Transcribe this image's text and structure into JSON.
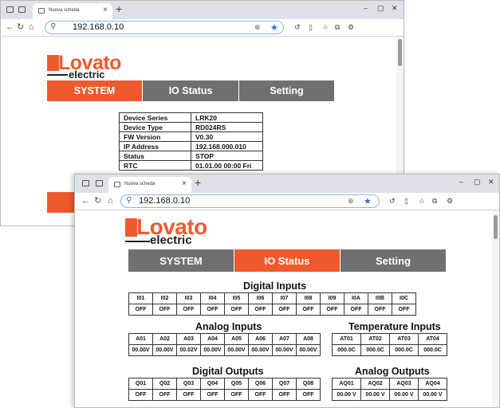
{
  "back_window": {
    "tab_title": "Nuova scheda",
    "url": "192.168.0.10",
    "logo_main": "Lovato",
    "logo_sub": "electric",
    "menu": [
      "SYSTEM",
      "IO Status",
      "Setting"
    ],
    "device_info": [
      {
        "label": "Device Series",
        "value": "LRK20"
      },
      {
        "label": "Device Type",
        "value": "RD024RS"
      },
      {
        "label": "FW Version",
        "value": "V0.30"
      },
      {
        "label": "IP Address",
        "value": "192.168.000.010"
      },
      {
        "label": "Status",
        "value": "STOP"
      },
      {
        "label": "RTC",
        "value": "01.01.00 00:00 Fri"
      }
    ]
  },
  "front_window": {
    "tab_title": "Nuova scheda",
    "url": "192.168.0.10",
    "logo_main": "Lovato",
    "logo_sub": "electric",
    "menu": [
      "SYSTEM",
      "IO Status",
      "Setting"
    ],
    "digital_inputs": {
      "title": "Digital Inputs",
      "headers": [
        "I01",
        "I02",
        "I03",
        "I04",
        "I05",
        "I06",
        "I07",
        "I08",
        "I09",
        "I0A",
        "I0B",
        "I0C"
      ],
      "values": [
        "OFF",
        "OFF",
        "OFF",
        "OFF",
        "OFF",
        "OFF",
        "OFF",
        "OFF",
        "OFF",
        "OFF",
        "OFF",
        "OFF"
      ]
    },
    "analog_inputs": {
      "title": "Analog Inputs",
      "headers": [
        "A01",
        "A02",
        "A03",
        "A04",
        "A05",
        "A06",
        "A07",
        "A08"
      ],
      "values": [
        "00.00V",
        "00.00V",
        "00.02V",
        "00.00V",
        "00.00V",
        "00.00V",
        "00.00V",
        "00.00V"
      ]
    },
    "temperature_inputs": {
      "title": "Temperature Inputs",
      "headers": [
        "AT01",
        "AT02",
        "AT03",
        "AT04"
      ],
      "values": [
        "000.0C",
        "000.0C",
        "000.0C",
        "000.0C"
      ]
    },
    "digital_outputs": {
      "title": "Digital Outputs",
      "headers": [
        "Q01",
        "Q02",
        "Q03",
        "Q04",
        "Q05",
        "Q06",
        "Q07",
        "Q08"
      ],
      "values": [
        "OFF",
        "OFF",
        "OFF",
        "OFF",
        "OFF",
        "OFF",
        "OFF",
        "OFF"
      ]
    },
    "analog_outputs": {
      "title": "Analog Outputs",
      "headers": [
        "AQ01",
        "AQ02",
        "AQ03",
        "AQ04"
      ],
      "values": [
        "00.00 V",
        "00.00 V",
        "00.00 V",
        "00.00 V"
      ]
    }
  }
}
